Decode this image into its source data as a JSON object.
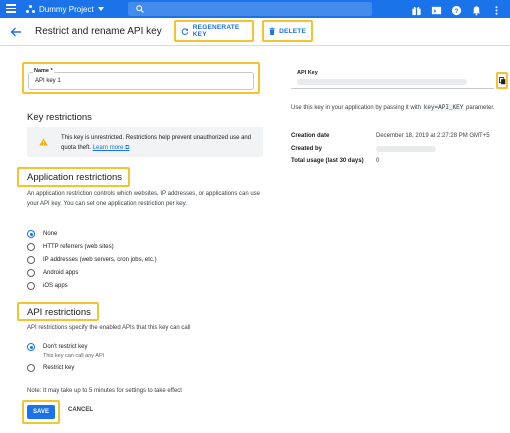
{
  "topbar": {
    "project_name": "Dummy Project",
    "color": "#1a73e8",
    "icons": [
      "gift-icon",
      "terminal-icon",
      "help-icon",
      "bell-icon",
      "more-vert-icon"
    ]
  },
  "header": {
    "title": "Restrict and rename API key",
    "regenerate_label": "REGENERATE KEY",
    "delete_label": "DELETE"
  },
  "name_field": {
    "label": "Name *",
    "value": "API key 1"
  },
  "key_restrictions": {
    "title": "Key restrictions",
    "warning_text": "This key is unrestricted. Restrictions help prevent unauthorized use and quota theft.",
    "learn_more": "Learn more"
  },
  "application_restrictions": {
    "title": "Application restrictions",
    "description": "An application restriction controls which websites, IP addresses, or applications can use your API key. You can set one application restriction per key.",
    "options": [
      {
        "label": "None",
        "checked": true
      },
      {
        "label": "HTTP referrers (web sites)",
        "checked": false
      },
      {
        "label": "IP addresses (web servers, cron jobs, etc.)",
        "checked": false
      },
      {
        "label": "Android apps",
        "checked": false
      },
      {
        "label": "iOS apps",
        "checked": false
      }
    ]
  },
  "api_restrictions": {
    "title": "API restrictions",
    "description": "API restrictions specify the enabled APIs that this key can call",
    "options": [
      {
        "label": "Don't restrict key",
        "sublabel": "This key can call any API",
        "checked": true
      },
      {
        "label": "Restrict key",
        "checked": false
      }
    ]
  },
  "note": "Note: It may take up to 5 minutes for settings to take effect",
  "actions": {
    "save": "SAVE",
    "cancel": "CANCEL"
  },
  "api_key": {
    "label": "API Key",
    "help_prefix": "Use this key in your application by passing it with",
    "help_code": "key=API_KEY",
    "help_suffix": "parameter."
  },
  "meta": {
    "creation_date_label": "Creation date",
    "creation_date_value": "December 18, 2019 at 2:27:28 PM GMT+5",
    "created_by_label": "Created by",
    "total_usage_label": "Total usage (last 30 days)",
    "total_usage_value": "0"
  },
  "colors": {
    "accent": "#1a73e8",
    "highlight": "#f4c430",
    "warning": "#f9ab00"
  }
}
